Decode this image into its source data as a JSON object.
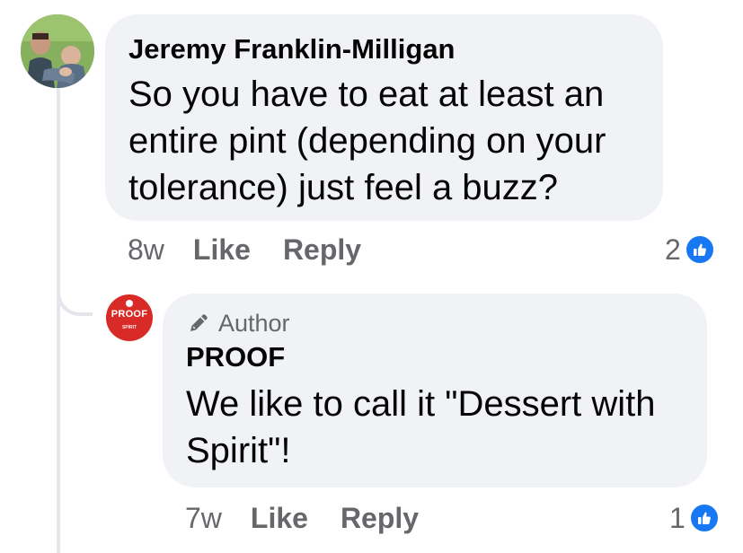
{
  "comments": [
    {
      "author": "Jeremy Franklin-Milligan",
      "text": "So you have to eat at least an entire pint (depending on your tolerance) just feel a buzz?",
      "time": "8w",
      "like_label": "Like",
      "reply_label": "Reply",
      "reaction_count": "2",
      "avatar_icon": "profile-photo"
    }
  ],
  "reply": {
    "badge": "Author",
    "badge_icon": "pencil-icon",
    "author": "PROOF",
    "text": "We like to call it \"Dessert with Spirit\"!",
    "time": "7w",
    "like_label": "Like",
    "reply_label": "Reply",
    "reaction_count": "1",
    "avatar": {
      "logo_text": "PROOF",
      "logo_subtext": "SPIRIT"
    }
  },
  "colors": {
    "bubble_bg": "#f0f2f5",
    "secondary_text": "#65676b",
    "like_blue": "#1877f2",
    "brand_red": "#d82b27"
  }
}
